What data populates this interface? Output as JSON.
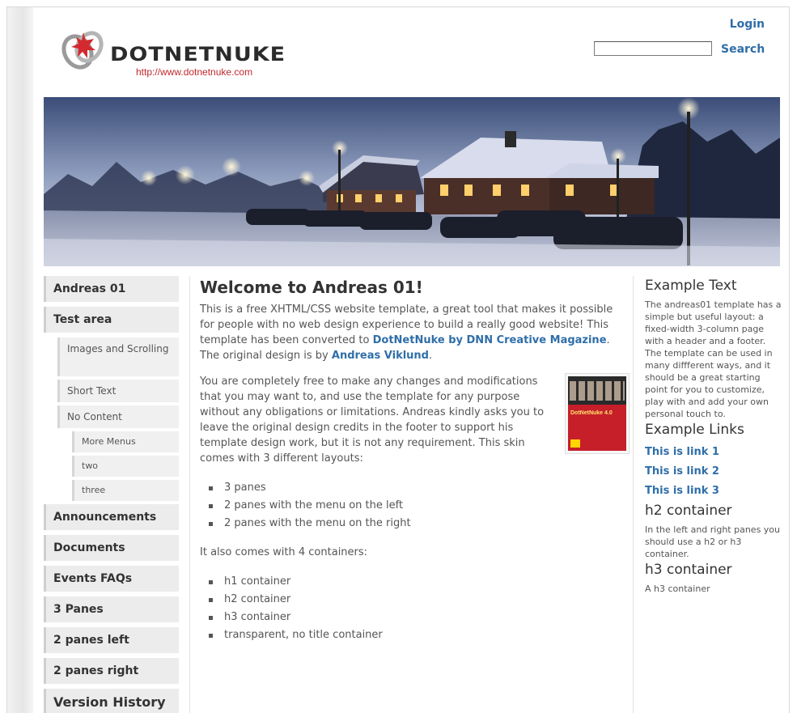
{
  "header": {
    "logo_text": "DOTNETNUKE",
    "logo_url": "http://www.dotnetnuke.com",
    "login_label": "Login",
    "search_label": "Search",
    "search_value": ""
  },
  "nav": {
    "items": [
      {
        "label": "Andreas 01"
      },
      {
        "label": "Test area"
      },
      {
        "label": "Images and Scrolling"
      },
      {
        "label": "Short Text"
      },
      {
        "label": "No Content"
      },
      {
        "label": "More Menus"
      },
      {
        "label": "two"
      },
      {
        "label": "three"
      },
      {
        "label": "Announcements"
      },
      {
        "label": "Documents"
      },
      {
        "label": "Events FAQs"
      },
      {
        "label": "3 Panes"
      },
      {
        "label": "2 panes left"
      },
      {
        "label": "2 panes right"
      },
      {
        "label": "Version History"
      }
    ]
  },
  "main": {
    "title": "Welcome to Andreas 01!",
    "p1_a": "This is a free XHTML/CSS website template, a great tool that makes it possible for people with no web design experience to build a really good website! This template has been converted to ",
    "p1_link1": "DotNetNuke by DNN Creative Magazine",
    "p1_b": ". The original design is by ",
    "p1_link2": "Andreas Viklund",
    "p1_c": ".",
    "p2": "You are completely free to make any changes and modifications that you may want to, and use the template for any purpose without any obligations or limitations. Andreas kindly asks you to leave the original design credits in the footer to support his template design work, but it is not any requirement. This skin comes with 3 different layouts:",
    "book_title": "DotNetNuke 4.0",
    "layouts": [
      "3 panes",
      "2 panes with the menu on the left",
      "2 panes with the menu on the right"
    ],
    "p3": "It also comes with 4 containers:",
    "containers": [
      "h1 container",
      "h2 container",
      "h3 container",
      "transparent, no title container"
    ]
  },
  "right": {
    "example_text_title": "Example Text",
    "example_text_body": "The andreas01 template has a simple but useful layout: a fixed-width 3-column page with a header and a footer. The template can be used in many diffferent ways, and it should be a great starting point for you to customize, play with and add your own personal touch to.",
    "example_links_title": "Example Links",
    "links": [
      "This is link 1",
      "This is link 2",
      "This is link 3"
    ],
    "h2_title": "h2 container",
    "h2_body": "In the left and right panes you should use a h2 or h3 container.",
    "h3_title": "h3 container",
    "h3_body": "A h3 container"
  },
  "colors": {
    "link": "#2f6ea8",
    "logo_red": "#c0282d",
    "nav_bg": "#ececec"
  }
}
